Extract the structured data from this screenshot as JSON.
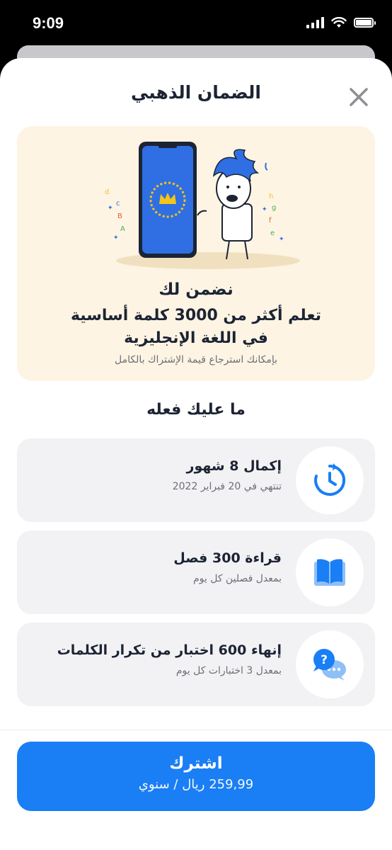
{
  "status_bar": {
    "time": "9:09"
  },
  "header": {
    "title": "الضمان الذهبي"
  },
  "hero": {
    "heading": "نضمن لك",
    "main_line1": "تعلم أكثر من 3000 كلمة أساسية",
    "main_line2": "في اللغة الإنجليزية",
    "note": "بإمكانك استرجاع قيمة الإشتراك بالكامل",
    "letters_left": [
      "d",
      "c",
      "B",
      "A"
    ],
    "letters_right": [
      "h",
      "g",
      "f",
      "e"
    ]
  },
  "section": {
    "title": "ما عليك فعله"
  },
  "tasks": [
    {
      "title": "إكمال 8 شهور",
      "subtitle": "تنتهي في 20 فبراير 2022",
      "icon": "clock-refresh-icon"
    },
    {
      "title": "قراءة 300 فصل",
      "subtitle": "بمعدل فصلين كل يوم",
      "icon": "book-icon"
    },
    {
      "title": "إنهاء 600 اختبار من تكرار الكلمات",
      "subtitle": "بمعدل 3 اختبارات كل يوم",
      "icon": "chat-question-icon"
    }
  ],
  "footer": {
    "subscribe_label": "اشترك",
    "price": "259,99 ريال / سنوي"
  },
  "colors": {
    "accent": "#1a7ef5",
    "hero_bg": "#fdf4e3",
    "card_bg": "#f2f2f5",
    "text": "#1c2434",
    "crown": "#f5c518"
  }
}
